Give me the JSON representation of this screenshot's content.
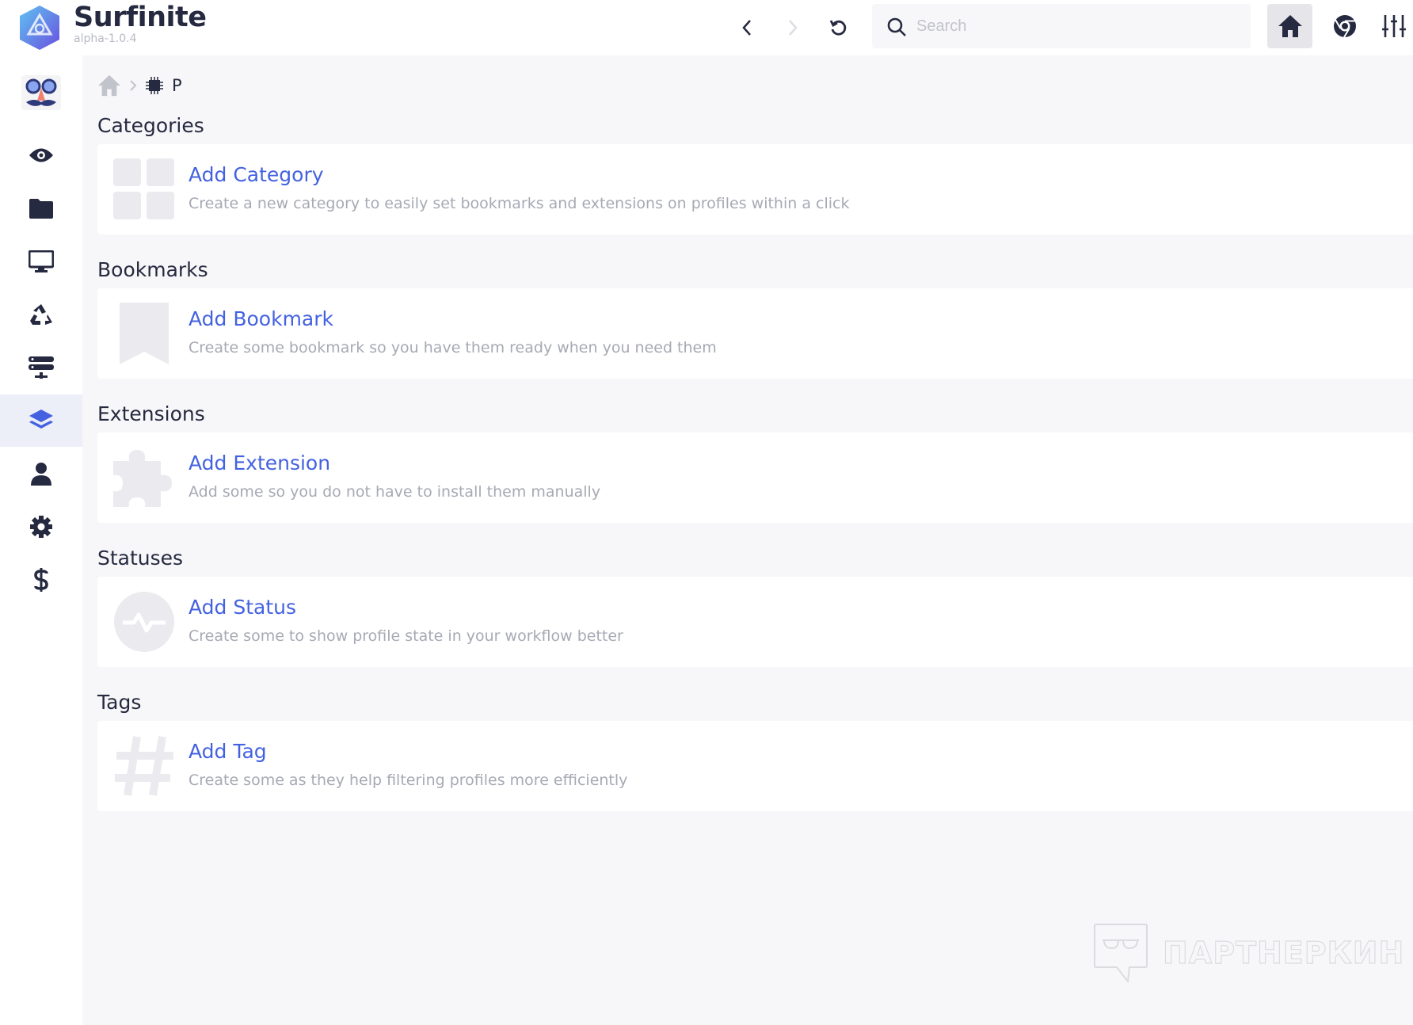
{
  "app": {
    "name": "Surfinite",
    "version": "alpha-1.0.4"
  },
  "search": {
    "placeholder": "Search",
    "value": ""
  },
  "breadcrumb": {
    "current": "P"
  },
  "sections": [
    {
      "heading": "Categories",
      "title": "Add Category",
      "description": "Create a new category to easily set bookmarks and extensions on profiles within a click"
    },
    {
      "heading": "Bookmarks",
      "title": "Add Bookmark",
      "description": "Create some bookmark so you have them ready when you need them"
    },
    {
      "heading": "Extensions",
      "title": "Add Extension",
      "description": "Add some so you do not have to install them manually"
    },
    {
      "heading": "Statuses",
      "title": "Add Status",
      "description": "Create some to show profile state in your workflow better"
    },
    {
      "heading": "Tags",
      "title": "Add Tag",
      "description": "Create some as they help filtering profiles more efficiently"
    }
  ],
  "watermark": "ПАРТНЕРКИН",
  "colors": {
    "accent": "#4462e0",
    "text": "#262a40",
    "muted": "#a7a9b4",
    "active_bg": "#eceef8"
  }
}
